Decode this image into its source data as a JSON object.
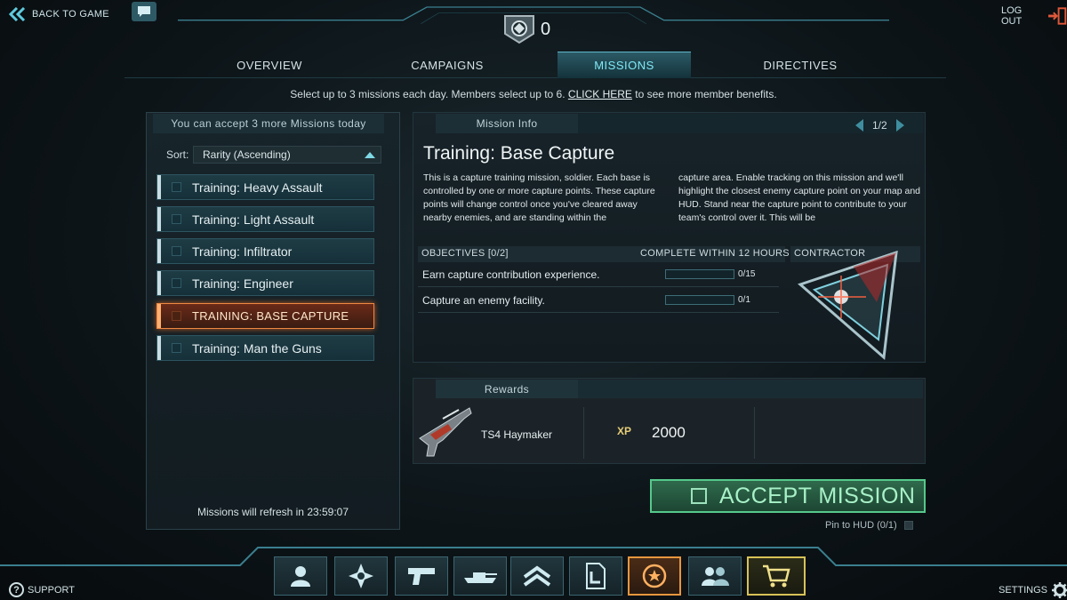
{
  "topbar": {
    "back_label": "BACK TO GAME",
    "certs": "0",
    "logout_label": "LOG OUT"
  },
  "tabs": [
    {
      "label": "OVERVIEW",
      "active": false
    },
    {
      "label": "CAMPAIGNS",
      "active": false
    },
    {
      "label": "MISSIONS",
      "active": true
    },
    {
      "label": "DIRECTIVES",
      "active": false
    }
  ],
  "info": {
    "before": "Select up to 3 missions each day. Members select up to 6. ",
    "link": "CLICK HERE",
    "after": " to see more member benefits."
  },
  "missions_panel": {
    "header": "You can accept 3 more Missions today",
    "sort_label": "Sort:",
    "sort_value": "Rarity (Ascending)",
    "items": [
      {
        "label": "Training: Heavy Assault",
        "selected": false
      },
      {
        "label": "Training: Light Assault",
        "selected": false
      },
      {
        "label": "Training: Infiltrator",
        "selected": false
      },
      {
        "label": "Training: Engineer",
        "selected": false
      },
      {
        "label": "TRAINING: BASE CAPTURE",
        "selected": true
      },
      {
        "label": "Training: Man the Guns",
        "selected": false
      }
    ],
    "refresh": "Missions will refresh in 23:59:07"
  },
  "mission_info": {
    "header": "Mission Info",
    "page": "1/2",
    "title": "Training: Base Capture",
    "desc_col1": "This is a capture training mission, soldier. Each base is controlled by one or more capture points. These capture points will change control once you've cleared away nearby enemies, and are standing within the",
    "desc_col2": "capture area. Enable tracking on this mission and we'll highlight the closest enemy capture point on your map and HUD. Stand near the capture point to contribute to your team's control over it. This will be",
    "objectives_label": "OBJECTIVES [0/2]",
    "complete_within": "COMPLETE WITHIN 12 HOURS",
    "contractor_label": "CONTRACTOR",
    "objectives": [
      {
        "text": "Earn capture contribution experience.",
        "progress": "0/15",
        "fraction": 0
      },
      {
        "text": "Capture an enemy facility.",
        "progress": "0/1",
        "fraction": 0
      }
    ]
  },
  "rewards": {
    "header": "Rewards",
    "item_name": "TS4 Haymaker",
    "xp_badge": "XP",
    "xp_value": "2000"
  },
  "accept_label": "ACCEPT MISSION",
  "pin_label": "Pin to HUD (0/1)",
  "bottom_nav": [
    {
      "icon": "character-icon"
    },
    {
      "icon": "squad-emblem-icon"
    },
    {
      "icon": "weapon-pistol-icon"
    },
    {
      "icon": "vehicle-tank-icon"
    },
    {
      "icon": "rank-chevron-icon"
    },
    {
      "icon": "directive-document-icon"
    },
    {
      "icon": "missions-medal-icon",
      "active": true
    },
    {
      "icon": "friends-icon"
    },
    {
      "icon": "shopping-cart-icon"
    }
  ],
  "support_label": "SUPPORT",
  "settings_label": "SETTINGS",
  "colors": {
    "accent_cyan": "#7fe8f5",
    "selected_orange": "#ee8844",
    "accept_green": "#55c98b",
    "xp_gold": "#e6cd78"
  }
}
